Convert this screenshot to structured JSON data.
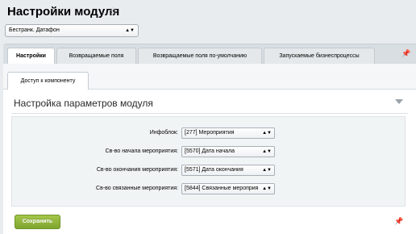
{
  "page": {
    "title": "Настройки модуля",
    "star_icon": "☆"
  },
  "site_selector": {
    "value": "Бестранк. Датафон"
  },
  "tabs": [
    {
      "label": "Настройки",
      "active": true
    },
    {
      "label": "Возвращаемые поля",
      "active": false
    },
    {
      "label": "Возвращаемые поля по-умолчанию",
      "active": false
    },
    {
      "label": "Запускаемые бизнеспроцессы",
      "active": false
    }
  ],
  "subtabs": [
    {
      "label": "Доступ к компоненту",
      "active": true
    }
  ],
  "section": {
    "title": "Настройка параметров модуля"
  },
  "form": {
    "rows": [
      {
        "label": "Инфоблок:",
        "value": "[277] Мероприятия"
      },
      {
        "label": "Св-во начала мероприятия:",
        "value": "[5570] Дата начала"
      },
      {
        "label": "Св-во окончания мероприятия:",
        "value": "[5571] Дата окончания"
      },
      {
        "label": "Св-во связанные мероприятия:",
        "value": "[5844] Связанные мероприя"
      }
    ]
  },
  "actions": {
    "save_label": "Сохранить"
  },
  "icons": {
    "pin": "pin-icon",
    "collapse": "chevron-down-icon",
    "star": "star-icon"
  },
  "colors": {
    "save_button": "#8bb33a",
    "background": "#e9ecef"
  }
}
